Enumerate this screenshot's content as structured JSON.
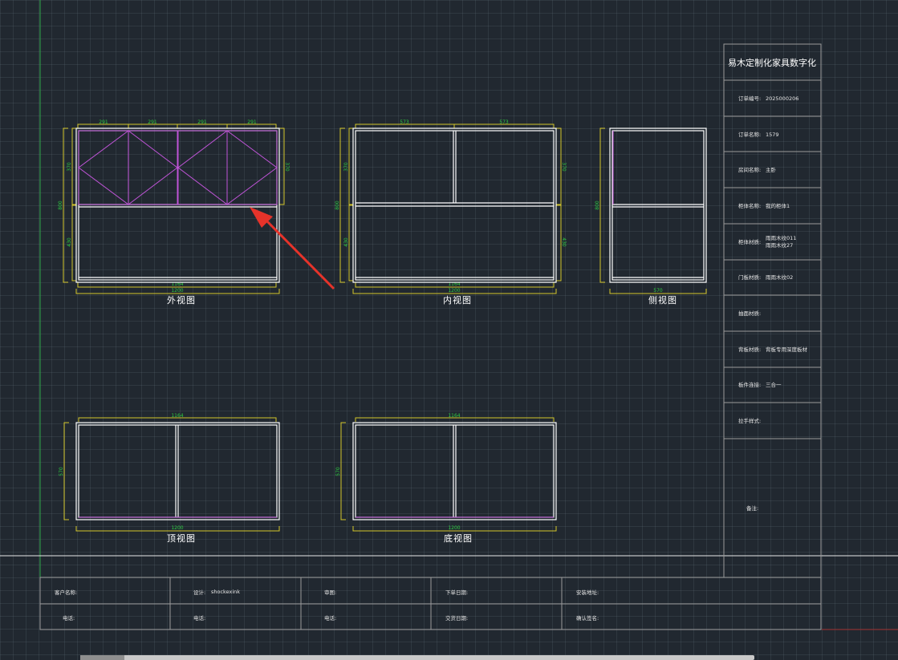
{
  "colors": {
    "background": "#212830",
    "frame_line": "#ffffff",
    "dimension": "#d4c62a",
    "dimension_text": "#2ecc40",
    "door_line": "#c054d8",
    "arrow": "#e6332a"
  },
  "views": {
    "front": {
      "label": "外视图",
      "dims": {
        "top": [
          "291",
          "291",
          "291",
          "291"
        ],
        "bottom_inner": "1164",
        "bottom_outer": "1200",
        "left_total": "800",
        "left_upper": "370",
        "left_lower": "430",
        "right_upper": "370"
      }
    },
    "inner": {
      "label": "内视图",
      "dims": {
        "top": [
          "573",
          "573"
        ],
        "bottom_inner": "1164",
        "bottom_outer": "1200",
        "left_total": "800",
        "left_upper": "370",
        "left_lower": "430",
        "right_upper": "370",
        "right_lower": "430"
      }
    },
    "side": {
      "label": "侧视图",
      "dims": {
        "left_total": "800",
        "bottom": "570"
      }
    },
    "top": {
      "label": "顶视图",
      "dims": {
        "top": "1164",
        "bottom": "1200",
        "left": "570"
      }
    },
    "bottom": {
      "label": "底视图",
      "dims": {
        "top": "1164",
        "bottom": "1200",
        "left": "570"
      }
    }
  },
  "title_block": {
    "company": "易木定制化家具数字化",
    "rows": [
      {
        "label": "订单编号:",
        "value": "2025000206"
      },
      {
        "label": "订单名称:",
        "value": "1579"
      },
      {
        "label": "房间名称:",
        "value": "主卧"
      },
      {
        "label": "柜体名称:",
        "value": "我的柜体1"
      },
      {
        "label": "柜体材质:",
        "value": "雨雨木纹011",
        "value2": "雨雨木纹27"
      },
      {
        "label": "门板材质:",
        "value": "雨雨木纹02"
      },
      {
        "label": "抽面材质:",
        "value": ""
      },
      {
        "label": "背板材质:",
        "value": "背板专用深度板材"
      },
      {
        "label": "板件连接:",
        "value": "三合一"
      },
      {
        "label": "拉手样式:",
        "value": ""
      }
    ],
    "remark_label": "备注:"
  },
  "bottom_table": {
    "row1": [
      {
        "label": "客户名称:",
        "value": ""
      },
      {
        "label": "设计:",
        "value": "shockexink"
      },
      {
        "label": "审图:",
        "value": ""
      },
      {
        "label": "下单日期:",
        "value": ""
      },
      {
        "label": "安装地址:",
        "value": ""
      }
    ],
    "row2": [
      {
        "label": "电话:",
        "value": ""
      },
      {
        "label": "电话:",
        "value": ""
      },
      {
        "label": "电话:",
        "value": ""
      },
      {
        "label": "交货日期:",
        "value": ""
      },
      {
        "label": "确认签名:",
        "value": ""
      }
    ]
  }
}
